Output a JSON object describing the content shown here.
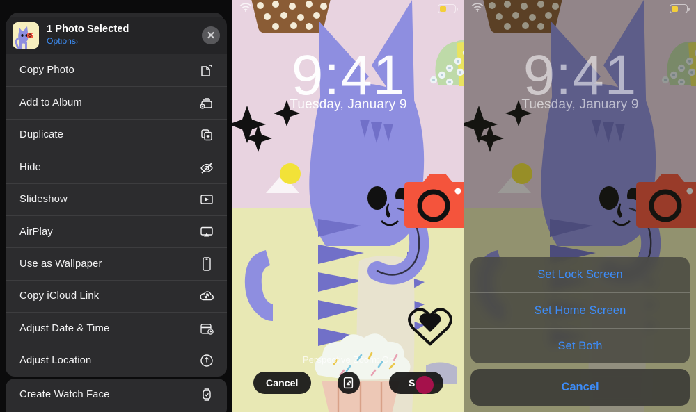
{
  "share_sheet": {
    "title": "1 Photo Selected",
    "options_label": "Options",
    "options_chevron": "›",
    "close_icon": "✕",
    "thumbnail_icon": "cat-with-camera-photo",
    "groups": [
      {
        "items": [
          {
            "label": "Copy Photo",
            "icon": "copy-photo-icon"
          },
          {
            "label": "Add to Album",
            "icon": "add-to-album-icon"
          },
          {
            "label": "Duplicate",
            "icon": "duplicate-icon"
          },
          {
            "label": "Hide",
            "icon": "hide-eye-slash-icon"
          },
          {
            "label": "Slideshow",
            "icon": "slideshow-play-icon"
          },
          {
            "label": "AirPlay",
            "icon": "airplay-icon"
          },
          {
            "label": "Use as Wallpaper",
            "icon": "iphone-icon"
          },
          {
            "label": "Copy iCloud Link",
            "icon": "icloud-link-icon"
          },
          {
            "label": "Adjust Date & Time",
            "icon": "calendar-clock-icon"
          },
          {
            "label": "Adjust Location",
            "icon": "location-info-icon"
          }
        ]
      },
      {
        "items": [
          {
            "label": "Create Watch Face",
            "icon": "watch-face-icon"
          }
        ]
      }
    ]
  },
  "preview_middle": {
    "status": {
      "wifi_icon": "wifi-icon",
      "battery_icon": "battery-low-power-icon"
    },
    "clock": "9:41",
    "date": "Tuesday, January 9",
    "perspective_zoom_label": "Perspective Zoom: On",
    "cancel_button": "Cancel",
    "set_button": "Set",
    "perspective_toggle_icon": "perspective-zoom-icon"
  },
  "preview_right": {
    "status": {
      "wifi_icon": "wifi-icon",
      "battery_icon": "battery-low-power-icon"
    },
    "clock": "9:41",
    "date": "Tuesday, January 9",
    "action_sheet": {
      "options": [
        {
          "label": "Set Lock Screen"
        },
        {
          "label": "Set Home Screen"
        },
        {
          "label": "Set Both"
        }
      ],
      "cancel": "Cancel"
    }
  },
  "colors": {
    "accent_blue": "#3d8dfb",
    "sheet_bg": "#2c2c2e",
    "wallpaper_sky": "#e8d3e0",
    "wallpaper_ground": "#e8e8b4",
    "cat_body": "#8e8ee0",
    "camera_red": "#f4543c",
    "home_dot": "#a5114b",
    "battery_yellow": "#f3cf3a"
  }
}
